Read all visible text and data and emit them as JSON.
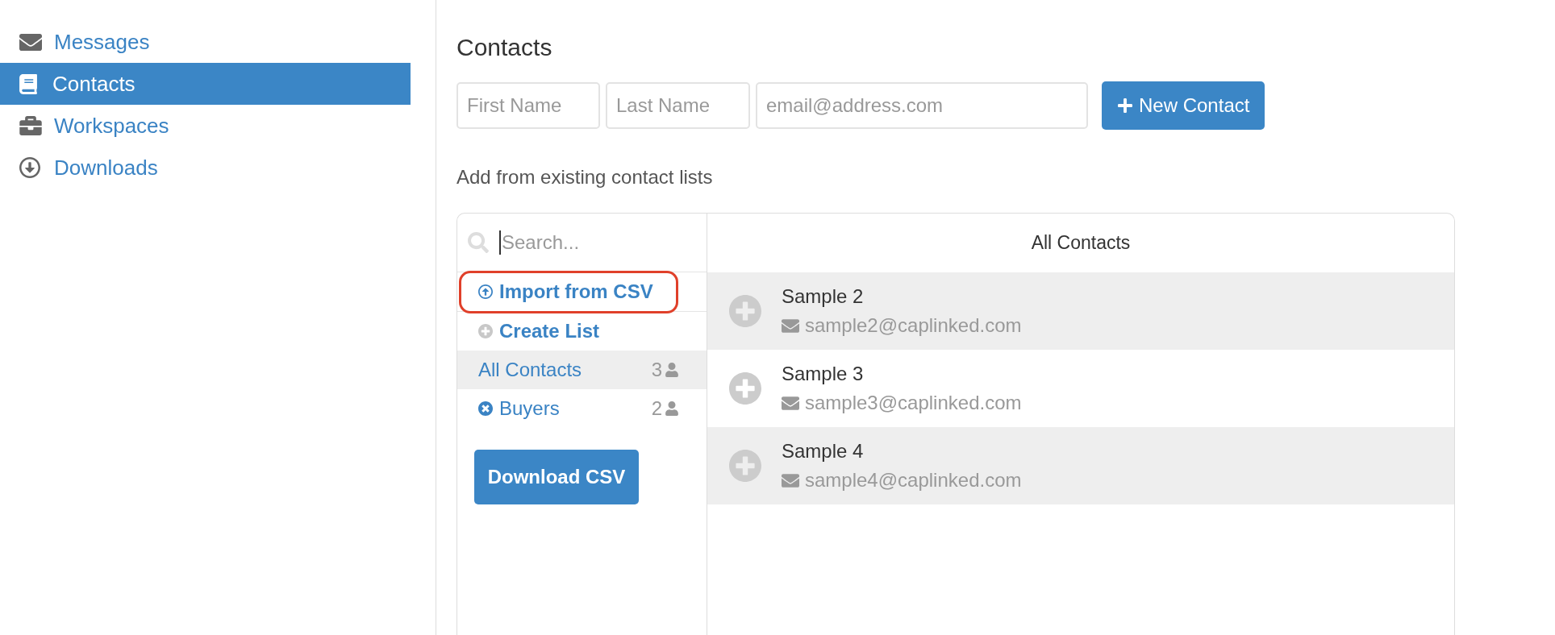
{
  "sidebar": {
    "items": [
      {
        "label": "Messages",
        "selected": false
      },
      {
        "label": "Contacts",
        "selected": true
      },
      {
        "label": "Workspaces",
        "selected": false
      },
      {
        "label": "Downloads",
        "selected": false
      }
    ]
  },
  "page": {
    "title": "Contacts"
  },
  "new_contact_form": {
    "fields": [
      {
        "placeholder": "First Name"
      },
      {
        "placeholder": "Last Name"
      },
      {
        "placeholder": "email@address.com"
      }
    ],
    "button": "New Contact"
  },
  "section_title": "Add from existing contact lists",
  "lists_panel": {
    "search": {
      "placeholder": "Search...",
      "focused": true
    },
    "actions": [
      {
        "kind": "import",
        "label": "Import from CSV",
        "highlighted": true
      },
      {
        "kind": "create",
        "label": "Create List",
        "highlighted": false
      }
    ],
    "lists": [
      {
        "name": "All Contacts",
        "count": "3",
        "selected": true,
        "removable": false
      },
      {
        "name": "Buyers",
        "count": "2",
        "selected": false,
        "removable": true
      }
    ],
    "download_button": "Download CSV"
  },
  "contacts_panel": {
    "title": "All Contacts",
    "contacts": [
      {
        "name": "Sample 2",
        "email": "sample2@caplinked.com"
      },
      {
        "name": "Sample 3",
        "email": "sample3@caplinked.com"
      },
      {
        "name": "Sample 4",
        "email": "sample4@caplinked.com"
      }
    ]
  }
}
